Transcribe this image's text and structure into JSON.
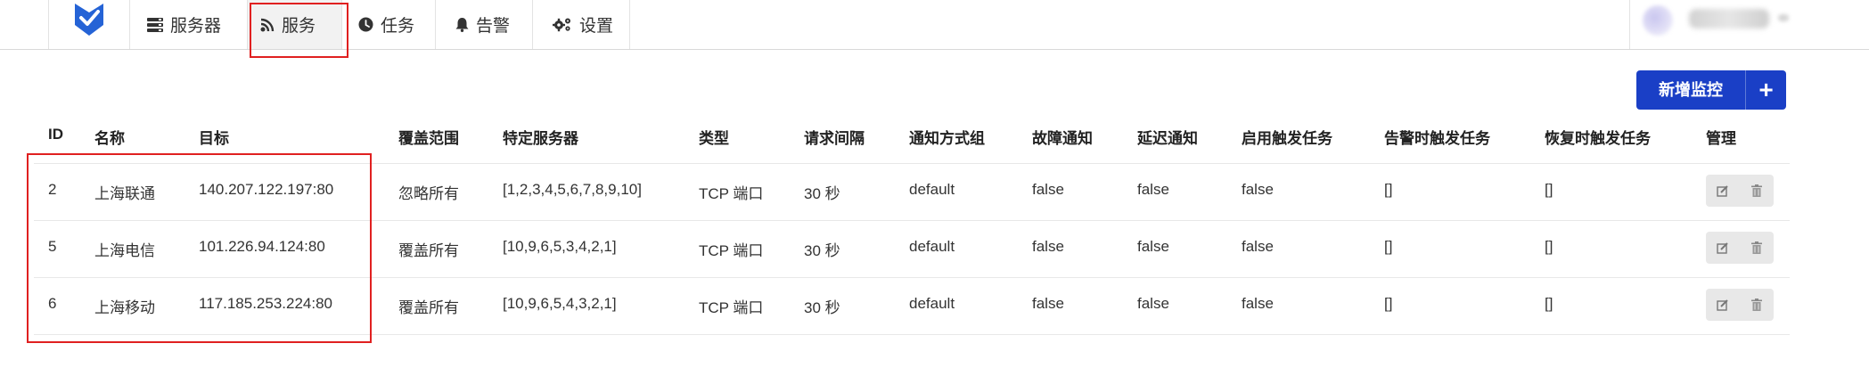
{
  "nav": {
    "items": [
      {
        "label": "服务器",
        "icon": "server-icon"
      },
      {
        "label": "服务",
        "icon": "rss-icon"
      },
      {
        "label": "任务",
        "icon": "clock-icon"
      },
      {
        "label": "告警",
        "icon": "bell-icon"
      },
      {
        "label": "设置",
        "icon": "cogs-icon"
      }
    ],
    "active": "服务"
  },
  "add_button": {
    "label": "新增监控",
    "icon": "plus-icon"
  },
  "table": {
    "headers": [
      "ID",
      "名称",
      "目标",
      "覆盖范围",
      "特定服务器",
      "类型",
      "请求间隔",
      "通知方式组",
      "故障通知",
      "延迟通知",
      "启用触发任务",
      "告警时触发任务",
      "恢复时触发任务",
      "管理"
    ],
    "rows": [
      [
        "2",
        "上海联通",
        "140.207.122.197:80",
        "忽略所有",
        "[1,2,3,4,5,6,7,8,9,10]",
        "TCP 端口",
        "30 秒",
        "default",
        "false",
        "false",
        "false",
        "[]",
        "[]"
      ],
      [
        "5",
        "上海电信",
        "101.226.94.124:80",
        "覆盖所有",
        "[10,9,6,5,3,4,2,1]",
        "TCP 端口",
        "30 秒",
        "default",
        "false",
        "false",
        "false",
        "[]",
        "[]"
      ],
      [
        "6",
        "上海移动",
        "117.185.253.224:80",
        "覆盖所有",
        "[10,9,6,5,4,3,2,1]",
        "TCP 端口",
        "30 秒",
        "default",
        "false",
        "false",
        "false",
        "[]",
        "[]"
      ]
    ]
  },
  "colors": {
    "accent": "#1a3fc6",
    "highlight": "#e02020",
    "logo": "#2563d6"
  }
}
